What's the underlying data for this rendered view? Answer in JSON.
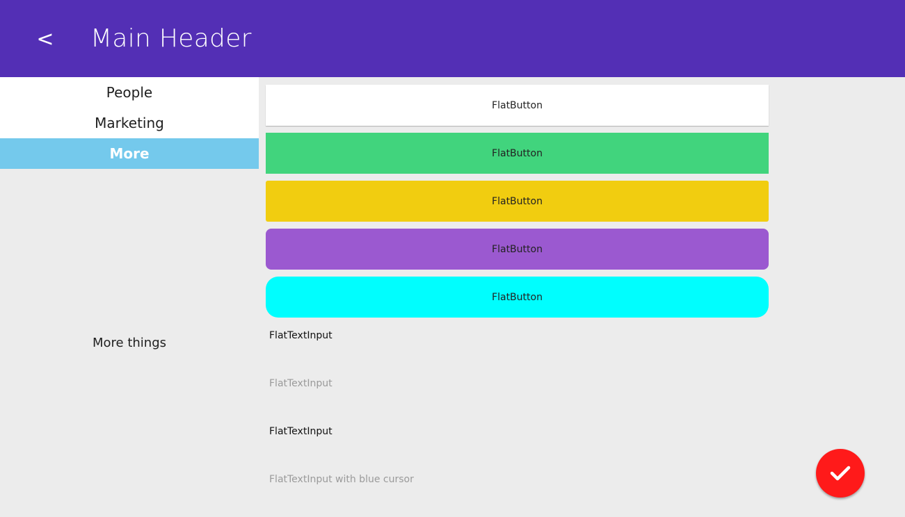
{
  "header": {
    "back_label": "<",
    "title": "Main Header",
    "background": "#532fb5"
  },
  "sidebar": {
    "items": [
      {
        "label": "People",
        "active": false
      },
      {
        "label": "Marketing",
        "active": false
      },
      {
        "label": "More",
        "active": true
      }
    ],
    "active_color": "#74c9ec",
    "extra_text": "More things"
  },
  "buttons": [
    {
      "label": "FlatButton",
      "color": "#ffffff"
    },
    {
      "label": "FlatButton",
      "color": "#41d47d"
    },
    {
      "label": "FlatButton",
      "color": "#f1cd10"
    },
    {
      "label": "FlatButton",
      "color": "#9b59d0"
    },
    {
      "label": "FlatButton",
      "color": "#00fefe"
    }
  ],
  "inputs": [
    {
      "value": "FlatTextInput",
      "placeholder": ""
    },
    {
      "value": "",
      "placeholder": "FlatTextInput"
    },
    {
      "value": "FlatTextInput",
      "placeholder": ""
    },
    {
      "value": "",
      "placeholder": "FlatTextInput with blue cursor"
    }
  ],
  "fab": {
    "icon": "checkmark-icon",
    "color": "#ff1a1a"
  }
}
